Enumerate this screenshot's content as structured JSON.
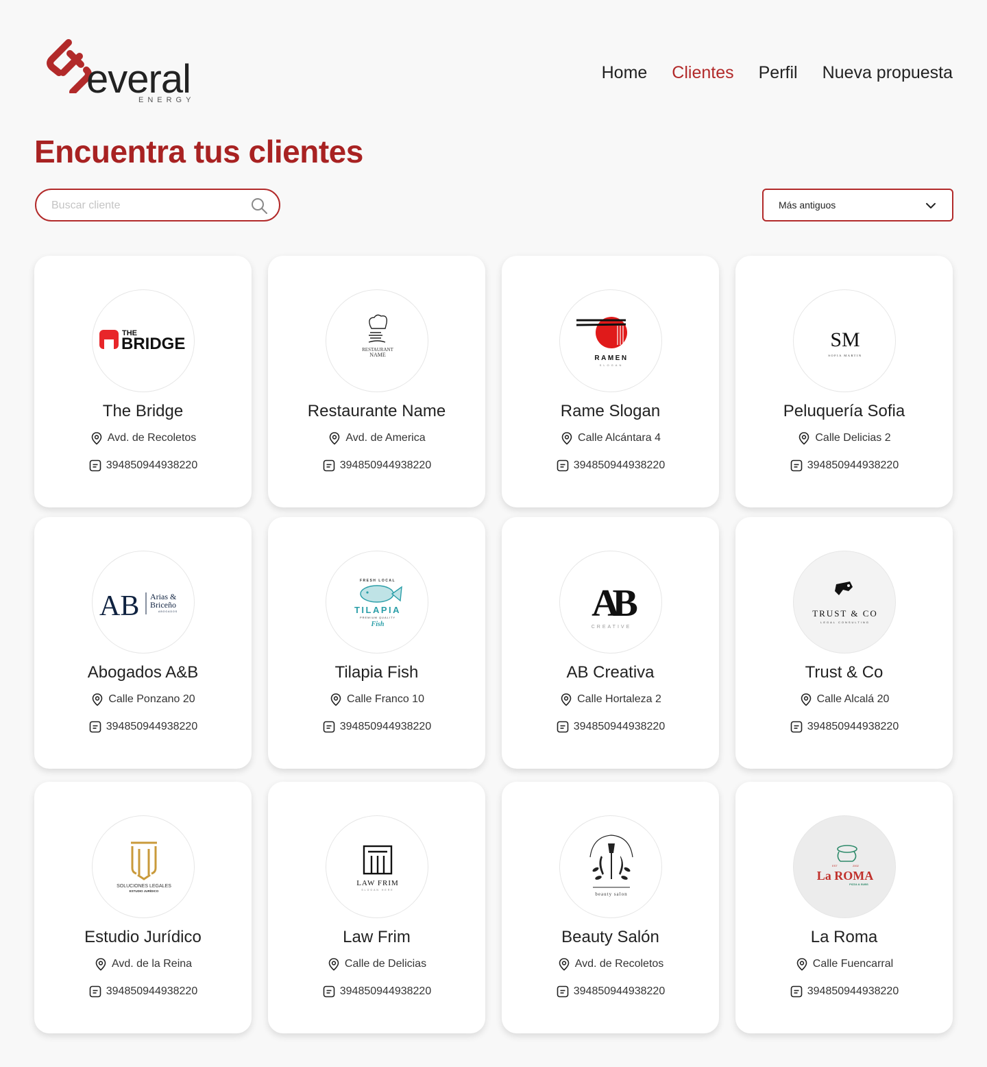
{
  "brand": {
    "word": "everal",
    "sub": "ENERGY"
  },
  "nav": [
    {
      "label": "Home",
      "active": false
    },
    {
      "label": "Clientes",
      "active": true
    },
    {
      "label": "Perfil",
      "active": false
    },
    {
      "label": "Nueva propuesta",
      "active": false
    }
  ],
  "page_title": "Encuentra tus clientes",
  "search": {
    "placeholder": "Buscar cliente",
    "value": "",
    "icon": "search-icon"
  },
  "sort": {
    "selected": "Más antiguos",
    "icon": "chevron-down-icon"
  },
  "colors": {
    "accent": "#a82222",
    "background": "#f8f8f8",
    "card": "#ffffff"
  },
  "clients": [
    {
      "name": "The Bridge",
      "address": "Avd. de Recoletos",
      "id": "394850944938220",
      "logo": "the-bridge-logo",
      "logo_text": [
        "THE",
        "BRIDGE"
      ]
    },
    {
      "name": "Restaurante Name",
      "address": "Avd. de America",
      "id": "394850944938220",
      "logo": "restaurant-logo",
      "logo_text": [
        "RESTAURANT",
        "NAME"
      ]
    },
    {
      "name": "Rame Slogan",
      "address": "Calle Alcántara 4",
      "id": "394850944938220",
      "logo": "ramen-logo",
      "logo_text": [
        "RAMEN",
        "SLOGAN"
      ]
    },
    {
      "name": "Peluquería Sofia",
      "address": "Calle Delicias 2",
      "id": "394850944938220",
      "logo": "sofia-martin-logo",
      "logo_text": [
        "SM",
        "SOFIA MARTIN"
      ]
    },
    {
      "name": "Abogados A&B",
      "address": "Calle Ponzano 20",
      "id": "394850944938220",
      "logo": "arias-briceno-logo",
      "logo_text": [
        "AB",
        "Arias &",
        "Briceño",
        "ABOGADOS"
      ]
    },
    {
      "name": "Tilapia Fish",
      "address": "Calle Franco 10",
      "id": "394850944938220",
      "logo": "tilapia-logo",
      "logo_text": [
        "FRESH LOCAL",
        "TILAPIA",
        "PREMIUM QUALITY",
        "Fish"
      ]
    },
    {
      "name": "AB Creativa",
      "address": "Calle Hortaleza 2",
      "id": "394850944938220",
      "logo": "ab-creative-logo",
      "logo_text": [
        "AB",
        "CREATIVE"
      ]
    },
    {
      "name": "Trust & Co",
      "address": "Calle Alcalá 20",
      "id": "394850944938220",
      "logo": "trust-co-logo",
      "logo_text": [
        "TRUST & CO",
        "LEGAL CONSULTING"
      ]
    },
    {
      "name": "Estudio Jurídico",
      "address": "Avd. de la Reina",
      "id": "394850944938220",
      "logo": "soluciones-legales-logo",
      "logo_text": [
        "SOLUCIONES LEGALES",
        "ESTUDIO JURÍDICO"
      ]
    },
    {
      "name": "Law Frim",
      "address": "Calle de Delicias",
      "id": "394850944938220",
      "logo": "law-firm-logo",
      "logo_text": [
        "LAW FRIM",
        "SLOGAN HERE"
      ]
    },
    {
      "name": "Beauty Salón",
      "address": "Avd. de Recoletos",
      "id": "394850944938220",
      "logo": "beauty-salon-logo",
      "logo_text": [
        "beauty salon"
      ]
    },
    {
      "name": "La Roma",
      "address": "Calle Fuencarral",
      "id": "394850944938220",
      "logo": "la-roma-logo",
      "logo_text": [
        "EST",
        "2002",
        "La ROMA",
        "PIZZA & SUBS"
      ]
    }
  ]
}
